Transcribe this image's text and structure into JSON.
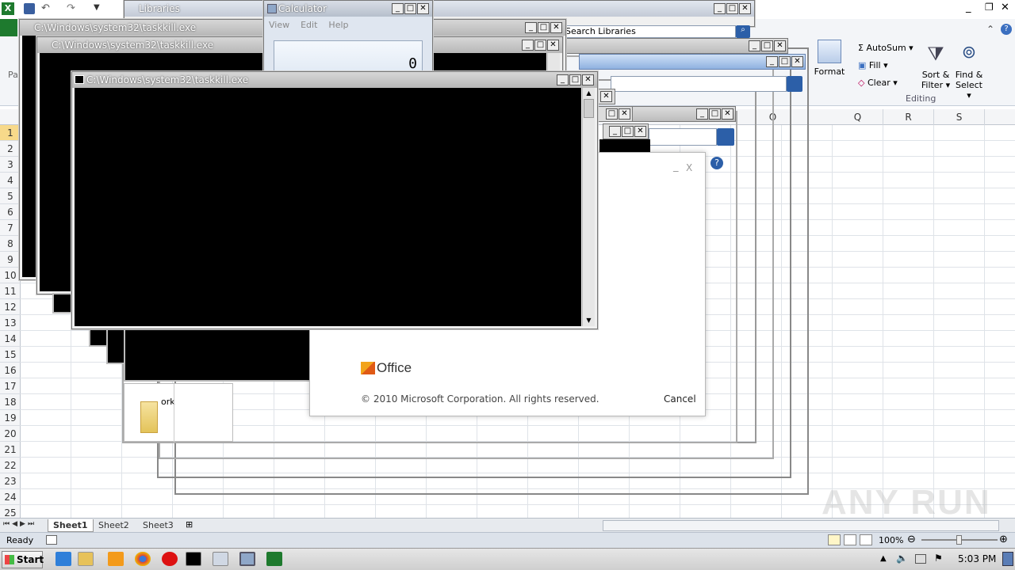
{
  "excel": {
    "quick_access_icons": [
      "save-icon",
      "undo-icon",
      "redo-icon",
      "customize-icon"
    ],
    "ribbon": {
      "format_label": "Format",
      "autosum_label": "AutoSum",
      "fill_label": "Fill",
      "clear_label": "Clear",
      "sort_filter_label_1": "Sort &",
      "sort_filter_label_2": "Filter",
      "find_select_label_1": "Find &",
      "find_select_label_2": "Select",
      "group_label": "Editing",
      "paste_label": "Pa"
    },
    "columns_right": [
      "Q",
      "R",
      "S"
    ],
    "column_partial": "O",
    "rows": [
      "1",
      "2",
      "3",
      "4",
      "5",
      "6",
      "7",
      "8",
      "9",
      "10",
      "11",
      "12",
      "13",
      "14",
      "15",
      "16",
      "17",
      "18",
      "19",
      "20",
      "21",
      "22",
      "23",
      "24",
      "25"
    ],
    "sheets": [
      "Sheet1",
      "Sheet2",
      "Sheet3"
    ],
    "status": "Ready",
    "zoom": "100%"
  },
  "windows": {
    "libraries": {
      "title": "Libraries",
      "search_placeholder": "Search Libraries"
    },
    "calculator": {
      "title": "Calculator",
      "menu": [
        "View",
        "Edit",
        "Help"
      ],
      "display": "0"
    },
    "taskkill_1": {
      "title": "C:\\Windows\\system32\\taskkill.exe"
    },
    "taskkill_2": {
      "title": "C:\\Windows\\system32\\taskkill.exe"
    },
    "taskkill_3": {
      "title": "C:\\Windows\\system32\\taskkill.exe"
    },
    "folder_fragment": {
      "text": "ork"
    }
  },
  "office_splash": {
    "logo_text": "Office",
    "copyright": "© 2010 Microsoft Corporation.  All rights reserved.",
    "cancel": "Cancel",
    "min": "_",
    "close": "X"
  },
  "taskbar": {
    "start": "Start",
    "clock": "5:03 PM"
  },
  "watermark": "ANY RUN"
}
